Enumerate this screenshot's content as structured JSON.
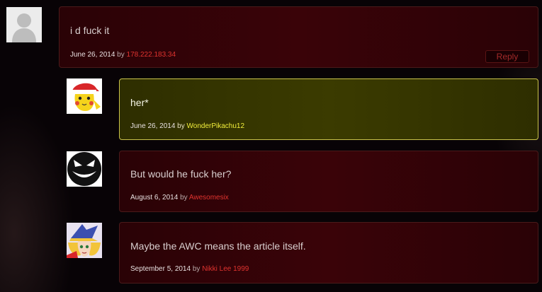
{
  "comments": [
    {
      "avatar": "default-gray-avatar-icon",
      "text": "i d fuck it",
      "date": "June 26, 2014",
      "by": "by",
      "author": "178.222.183.34",
      "reply_label": "Reply"
    },
    {
      "avatar": "pikachu-avatar-icon",
      "text": "her*",
      "date": "June 26, 2014",
      "by": "by",
      "author": "WonderPikachu12"
    },
    {
      "avatar": "grin-face-avatar-icon",
      "text": "But would he fuck her?",
      "date": "August 6, 2014",
      "by": "by",
      "author": "Awesomesix"
    },
    {
      "avatar": "dark-magician-girl-avatar-icon",
      "text": "Maybe the AWC means the article itself.",
      "date": "September 5, 2014",
      "by": "by",
      "author": "Nikki Lee 1999"
    }
  ],
  "colors": {
    "box_bg": "#3a0308",
    "highlight_bg": "#3b3b00",
    "author_link": "#e0332f",
    "highlight_author": "#f2ee3a"
  }
}
